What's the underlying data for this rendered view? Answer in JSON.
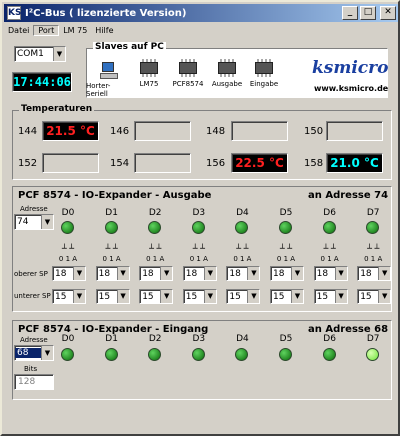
{
  "window": {
    "title": "I²C-Bus ( lizenzierte Version)",
    "app_icon": "KS",
    "minimize": "_",
    "maximize": "□",
    "close": "✕"
  },
  "menu": [
    "Datei",
    "Port",
    "LM 75",
    "Hilfe"
  ],
  "port": {
    "value": "COM1"
  },
  "clock": "17:44:06",
  "slaves": {
    "title": "Slaves auf PC",
    "items": [
      "Horter-Seriell",
      "LM75",
      "PCF8574",
      "Ausgabe",
      "Eingabe"
    ]
  },
  "logo": {
    "text": "ksmicro",
    "url": "www.ksmicro.de"
  },
  "temperatures": {
    "title": "Temperaturen",
    "sensors": [
      {
        "addr": "144",
        "value": "21.5 °C",
        "color": "#ff2020"
      },
      {
        "addr": "146",
        "value": ""
      },
      {
        "addr": "148",
        "value": ""
      },
      {
        "addr": "150",
        "value": ""
      },
      {
        "addr": "152",
        "value": ""
      },
      {
        "addr": "154",
        "value": ""
      },
      {
        "addr": "156",
        "value": "22.5 °C",
        "color": "#ff2020"
      },
      {
        "addr": "158",
        "value": "21.0 °C",
        "color": "#00ffff"
      }
    ]
  },
  "output": {
    "title": "PCF 8574 - IO-Expander - Ausgabe",
    "address_title": "an Adresse 74",
    "address_label": "Adresse",
    "address_value": "74",
    "bits": [
      "D0",
      "D1",
      "D2",
      "D3",
      "D4",
      "D5",
      "D6",
      "D7"
    ],
    "switch_labels": [
      "0 1 A",
      "0 1 A",
      "0 1 A",
      "0 1 A",
      "0 1 A",
      "0 1 A",
      "0 1 A",
      "0 1 A"
    ],
    "upper_label": "oberer SP",
    "lower_label": "unterer SP",
    "upper_values": [
      "18",
      "18",
      "18",
      "18",
      "18",
      "18",
      "18",
      "18"
    ],
    "lower_values": [
      "15",
      "15",
      "15",
      "15",
      "15",
      "15",
      "15",
      "15"
    ]
  },
  "input": {
    "title": "PCF 8574 - IO-Expander - Eingang",
    "address_title": "an Adresse 68",
    "address_label": "Adresse",
    "address_value": "68",
    "bits": [
      "D0",
      "D1",
      "D2",
      "D3",
      "D4",
      "D5",
      "D6",
      "D7"
    ],
    "led_on": [
      false,
      false,
      false,
      false,
      false,
      false,
      false,
      true
    ],
    "bits_label": "Bits",
    "bits_value": "128"
  },
  "colors": {
    "title_start": "#0a246a",
    "title_end": "#a6caf0",
    "face": "#d4d0c8",
    "led_green": "#3bb23b"
  }
}
